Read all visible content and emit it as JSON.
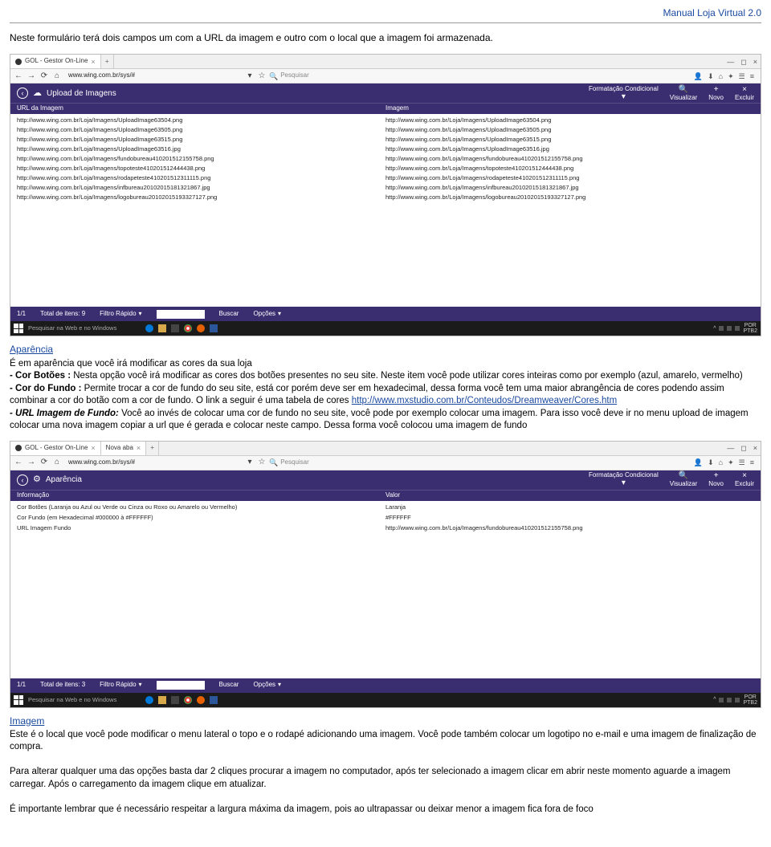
{
  "header": {
    "manual": "Manual Loja Virtual 2.0"
  },
  "intro": "Neste formulário terá dois campos um com a URL da imagem e outro com o local que a imagem foi armazenada.",
  "browser1": {
    "tab": "GOL - Gestor On-Line",
    "url": "www.wing.com.br/sys/#",
    "search_ph": "Pesquisar",
    "bar_title": "Upload de Imagens",
    "bar_right": [
      "Formatação Condicional",
      "Visualizar",
      "Novo",
      "Excluir"
    ],
    "cols": [
      "URL da Imagem",
      "Imagem"
    ],
    "rows": [
      [
        "http://www.wing.com.br/Loja/Imagens/UploadImage63504.png",
        "http://www.wing.com.br/Loja/Imagens/UploadImage63504.png"
      ],
      [
        "http://www.wing.com.br/Loja/Imagens/UploadImage63505.png",
        "http://www.wing.com.br/Loja/Imagens/UploadImage63505.png"
      ],
      [
        "http://www.wing.com.br/Loja/Imagens/UploadImage63515.png",
        "http://www.wing.com.br/Loja/Imagens/UploadImage63515.png"
      ],
      [
        "http://www.wing.com.br/Loja/Imagens/UploadImage63516.jpg",
        "http://www.wing.com.br/Loja/Imagens/UploadImage63516.jpg"
      ],
      [
        "http://www.wing.com.br/Loja/Imagens/fundobureau410201512155758.png",
        "http://www.wing.com.br/Loja/Imagens/fundobureau410201512155758.png"
      ],
      [
        "http://www.wing.com.br/Loja/Imagens/topoteste410201512444438.png",
        "http://www.wing.com.br/Loja/Imagens/topoteste410201512444438.png"
      ],
      [
        "http://www.wing.com.br/Loja/Imagens/rodapeteste410201512311115.png",
        "http://www.wing.com.br/Loja/Imagens/rodapeteste410201512311115.png"
      ],
      [
        "http://www.wing.com.br/Loja/Imagens/infbureau20102015181321867.jpg",
        "http://www.wing.com.br/Loja/Imagens/infbureau20102015181321867.jpg"
      ],
      [
        "http://www.wing.com.br/Loja/Imagens/logobureau20102015193327127.png",
        "http://www.wing.com.br/Loja/Imagens/logobureau20102015193327127.png"
      ]
    ],
    "footer": {
      "page": "1/1",
      "total": "Total de itens: 9",
      "filtro": "Filtro Rápido",
      "buscar": "Buscar",
      "opcoes": "Opções"
    },
    "taskbar_search": "Pesquisar na Web e no Windows",
    "lang": "POR\nPTB2"
  },
  "aparencia": {
    "title": "Aparência",
    "p1": "É em aparência que você irá modificar as cores da sua loja",
    "li1_label": "- Cor Botões :",
    "li1_text": " Nesta opção você irá modificar as cores dos botões presentes no seu site. Neste item você pode utilizar cores inteiras como por exemplo (azul, amarelo, vermelho)",
    "li2_label": "- Cor do Fundo :",
    "li2_text": " Permite trocar a cor de fundo do seu site, está cor porém deve ser em hexadecimal, dessa forma você tem uma maior abrangência de cores podendo assim combinar a cor do botão com a cor de fundo. O link a seguir é uma tabela de cores ",
    "li2_link": "http://www.mxstudio.com.br/Conteudos/Dreamweaver/Cores.htm",
    "li3_label": "- URL Imagem de Fundo:",
    "li3_text": " Você ao invés de colocar uma cor de fundo no seu site, você pode por exemplo colocar uma imagem. Para isso você deve ir no menu upload de imagem colocar uma nova imagem copiar a url que é gerada e colocar neste campo.  Dessa forma você colocou uma imagem de fundo"
  },
  "browser2": {
    "tab1": "GOL - Gestor On-Line",
    "tab2": "Nova aba",
    "url": "www.wing.com.br/sys/#",
    "search_ph": "Pesquisar",
    "bar_title": "Aparência",
    "bar_right": [
      "Formatação Condicional",
      "Visualizar",
      "Novo",
      "Excluir"
    ],
    "cols": [
      "Informação",
      "Valor"
    ],
    "rows": [
      [
        "Cor Botões (Laranja ou Azul ou Verde ou Cinza ou Roxo ou Amarelo ou Vermelho)",
        "Laranja"
      ],
      [
        "Cor Fundo (em Hexadecimal #000000 à #FFFFFF)",
        "#FFFFFF"
      ],
      [
        "URL Imagem Fundo",
        "http://www.wing.com.br/Loja/Imagens/fundobureau410201512155758.png"
      ]
    ],
    "footer": {
      "page": "1/1",
      "total": "Total de itens: 3",
      "filtro": "Filtro Rápido",
      "buscar": "Buscar",
      "opcoes": "Opções"
    },
    "taskbar_search": "Pesquisar na Web e no Windows",
    "lang": "POR\nPTB2"
  },
  "imagem": {
    "title": "Imagem",
    "p1": "Este é o local que você pode modificar o menu lateral o topo e o rodapé adicionando uma imagem. Você pode também colocar um logotipo no e-mail e uma imagem de  finalização de compra.",
    "p2": "Para alterar qualquer uma das opções basta dar 2 cliques procurar a imagem no computador, após ter selecionado a imagem clicar em abrir neste momento aguarde a imagem carregar. Após o carregamento da imagem clique em atualizar.",
    "p3": "É importante lembrar que é necessário respeitar a largura máxima da imagem, pois ao ultrapassar ou deixar menor a imagem fica fora de foco"
  }
}
